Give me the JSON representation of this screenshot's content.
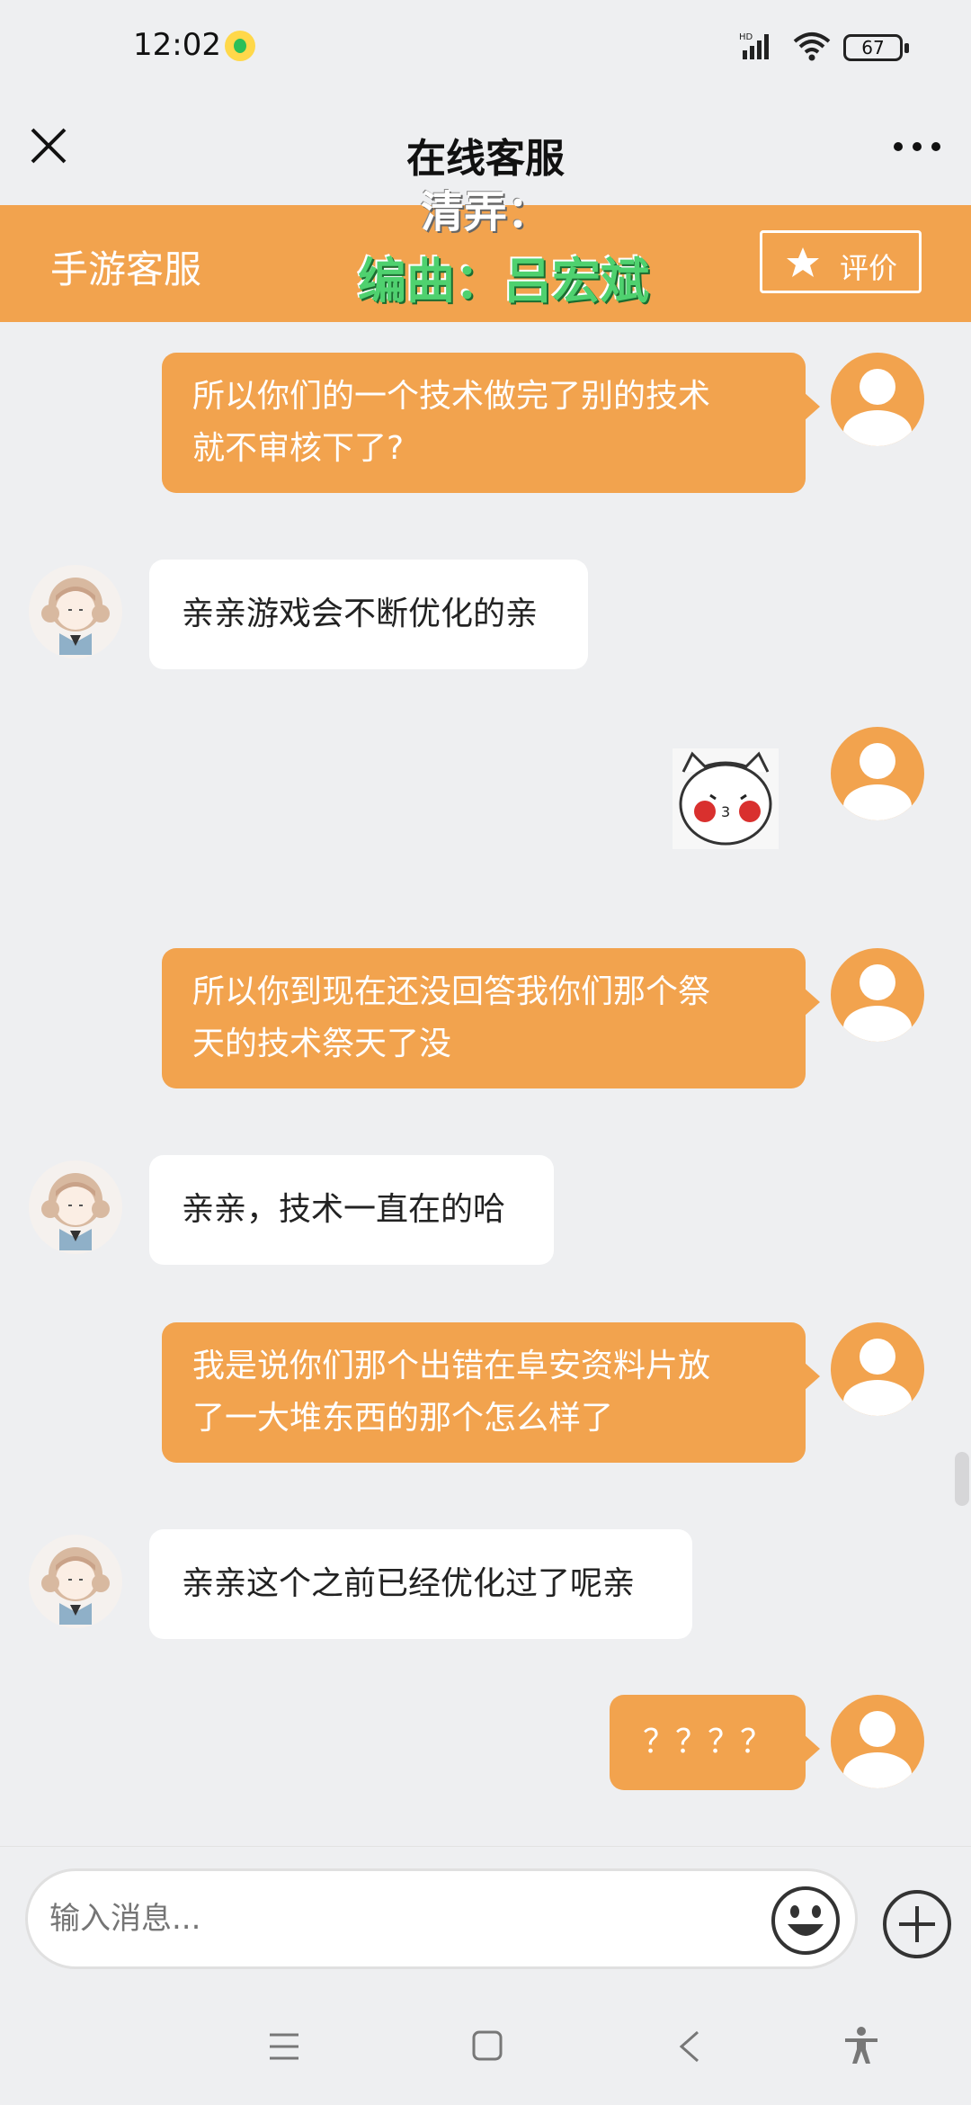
{
  "status_bar": {
    "time": "12:02",
    "battery": "67",
    "network": "HD"
  },
  "title_bar": {
    "title": "在线客服",
    "close_icon": "close-icon",
    "more_icon": "more-icon"
  },
  "service_header": {
    "name": "手游客服",
    "rate_label": "评价",
    "rate_icon": "star-icon",
    "accent_color": "#f2a34e"
  },
  "lyrics": {
    "line1": "清弄：",
    "line2": "编曲：吕宏斌"
  },
  "messages": [
    {
      "from": "user",
      "text_line1": "所以你们的一个技术做完了别的技术",
      "text_line2": "就不审核下了?"
    },
    {
      "from": "agent",
      "text": "亲亲游戏会不断优化的亲"
    },
    {
      "from": "user",
      "type": "sticker",
      "sticker": "cat-blush-sticker"
    },
    {
      "from": "user",
      "text_line1": "所以你到现在还没回答我你们那个祭",
      "text_line2": "天的技术祭天了没"
    },
    {
      "from": "agent",
      "text": "亲亲，技术一直在的哈"
    },
    {
      "from": "user",
      "text_line1": "我是说你们那个出错在阜安资料片放",
      "text_line2": "了一大堆东西的那个怎么样了"
    },
    {
      "from": "agent",
      "text": "亲亲这个之前已经优化过了呢亲"
    },
    {
      "from": "user",
      "text": "？？？？"
    }
  ],
  "input": {
    "placeholder": "输入消息...",
    "value": ""
  },
  "nav": {
    "menu_icon": "menu-icon",
    "home_icon": "home-icon",
    "back_icon": "back-icon",
    "accessibility_icon": "accessibility-icon"
  }
}
